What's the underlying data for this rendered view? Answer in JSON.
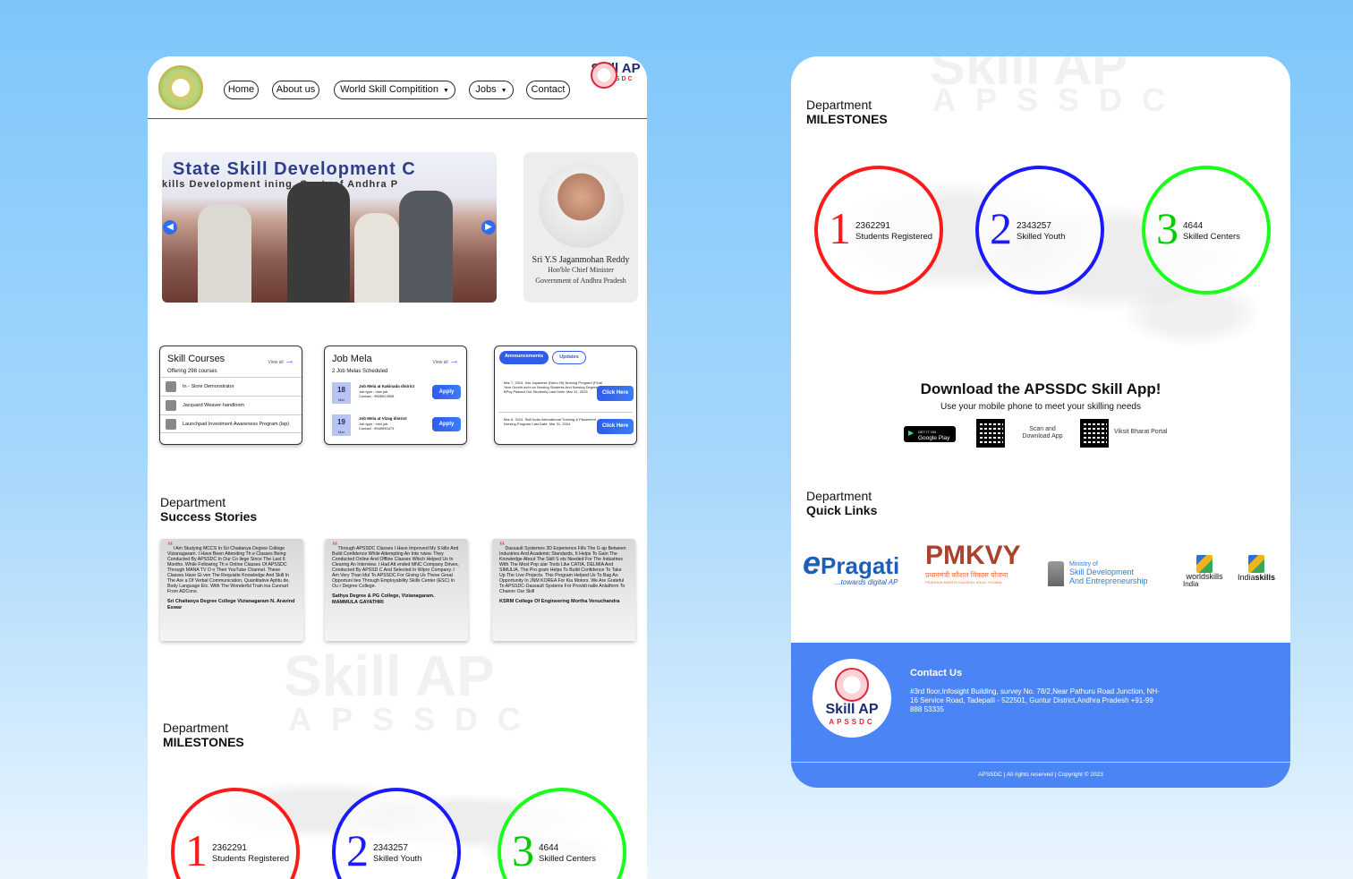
{
  "nav": {
    "home": "Home",
    "about": "About us",
    "wsc": "World Skill Compitition",
    "jobs": "Jobs",
    "contact": "Contact"
  },
  "brand": {
    "name": "Skill AP",
    "sub": "APSSDC"
  },
  "hero": {
    "banner": "State Skill Development C",
    "banner2": "kills Development     ining, Govt. of Andhra P",
    "prev_icon": "chevron-left-icon",
    "next_icon": "chevron-right-icon"
  },
  "cm": {
    "name": "Sri Y.S Jaganmohan Reddy",
    "title": "Hon'ble Chief Minister",
    "gov": "Government of Andhra Pradesh"
  },
  "courses": {
    "title": "Skill Courses",
    "view_all": "View all",
    "sub": "Offering 298 courses",
    "items": [
      "In - Store Demonstrator",
      "Jacquard Weaver-handloom",
      "Launchpad Investment Awareness Program (lap)"
    ]
  },
  "jobmela": {
    "title": "Job Mela",
    "view_all": "View all",
    "sub": "2 Job Melas Scheduled",
    "items": [
      {
        "day": "18",
        "month": "Mar",
        "title": "Job Mela at Kakinada district",
        "type": "Job type : mini job",
        "contact": "Contact : 9505023508",
        "btn": "Apply"
      },
      {
        "day": "19",
        "month": "Mar",
        "title": "Job Mela at Vizag district",
        "type": "Job type : mini job",
        "contact": "Contact : 9949590473",
        "btn": "Apply"
      }
    ]
  },
  "announce": {
    "tab1": "Announcements",
    "tab2": "Updates",
    "items": [
      {
        "text": "Mar 7, 2024. Into Japanese (Nano Hr) Nursing Program (Final Year Gnm/b.sc/m.sc Nursing Students And Nursing Degree BPsy Passed Out Students) Last Date: Mar 31, 2025",
        "btn": "Click Here"
      },
      {
        "text": "Mar 6, 2024. Skill India International Training & Placement Nursing Program Last Date: Mar 31, 2024",
        "btn": "Click Here"
      }
    ]
  },
  "success": {
    "small": "Department",
    "big": "Success Stories",
    "stories": [
      {
        "quote": "I Am Studying MCCS In Sri Chaitanya Degree College Vizianagaram. I Have Been Attending Th e Classes Being Conducted By APSSDC In Our Co llege Since The Last 6 Months. While Following Th e Online Classes Of APSSDC Through MANA TV O n Their YouTube Channel. These Classes Have Gi ven The Requisite Knowledge And Skill In The Are a Of Verbal Communication, Quantitative Aptitu de, Body Language Etc. With The Wonderful Train ina Cunnart From ADCons.",
        "who": "Sri Chaitanya Degree College Vizianagaram N. Aravind Eswar"
      },
      {
        "quote": "Through APSSDC Classes I Have Improved My S kills And Build Confidence While Attempting An Inte rview. They Conducted Online And Offline Classes Which Helped Us In Clearing An Interview. I Had Att ended MNC Company Drives, Conducted By APSSD C And Selected In Wipro Company. I Am Very Than kful To APSSDC For Giving Us These Great Opportuni ties Through Employability Skills Center (ESC) In Ou r Degree College.",
        "who": "Sathya Degree & PG College, Vizianagaram. MAMMULA GAYATHRI"
      },
      {
        "quote": "Dassault Systemes 3D Experience Fills The G ap Between Industries And Academic Standards, It Helps To Gain The Knowledge About The Skill S ets Needed For The Industries With The Most Pop ular Tools Like CATIA, DELMIA And SIMULIA. The Pro gram Helps To Build Confidence To Take Up The Live Projects. This Program Helped Us To Bag An Opportunity In JNM KOREA For Kia Motors. We Are Grateful To APSSDC-Dassault Systems For Providi nalle Anlatform To Chanon Our Skill",
        "who": "KSRM College Of Engineering Mortha Venuchandra"
      }
    ]
  },
  "milestones": {
    "small": "Department",
    "big": "MILESTONES",
    "items": [
      {
        "num": "1",
        "value": "2362291",
        "label": "Students Registered",
        "color": "#ff1a1a"
      },
      {
        "num": "2",
        "value": "2343257",
        "label": "Skilled Youth",
        "color": "#1a1aff"
      },
      {
        "num": "3",
        "value": "4644",
        "label": "Skilled Centers",
        "color": "#1aff1a"
      }
    ]
  },
  "app": {
    "title": "Download the APSSDC Skill App!",
    "sub": "Use your mobile phone to meet your skilling needs",
    "gp_top": "GET IT ON",
    "gp": "Google Play",
    "scan": "Scan and Download App",
    "viksit": "Viksit Bharat Portal"
  },
  "quick": {
    "small": "Department",
    "big": "Quick Links",
    "pragati": "Pragati",
    "pragati_e": "e",
    "pragati_tag": "...towards digital AP",
    "pmkvy": "PMKVY",
    "pmkvy_hi": "प्रधानमंत्री कौशल विकास योजना",
    "pmkvy_en": "PRADHAN MANTRI KAUSHAL VIKAS YOJANA",
    "ministry1": "Ministry of",
    "ministry2": "Skill Development",
    "ministry3": "And Entrepreneurship",
    "ws": "worldskills",
    "ws_india": "India",
    "india_skills_a": "India",
    "india_skills_b": "skills"
  },
  "footer": {
    "heading": "Contact Us",
    "address": "#3rd floor,Infosight Building, survey No. 78/2,Near Pathuru Road Junction, NH-16 Service Road, Tadepalli - 522501, Guntur District,Andhra Pradesh +91-99 888 53335",
    "copyright": "APSSDC | All rights reserved | Copyright © 2023"
  }
}
